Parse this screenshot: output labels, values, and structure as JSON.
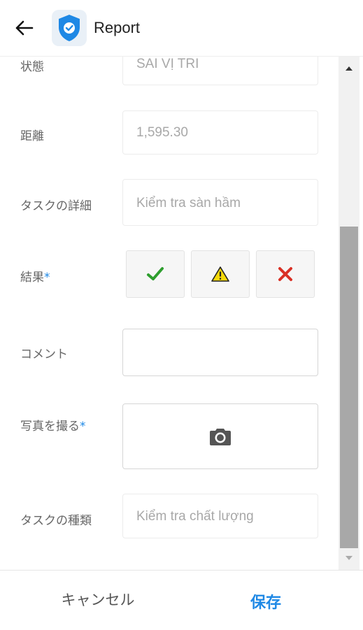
{
  "header": {
    "title": "Report",
    "back_icon": "arrow-left-icon",
    "logo_icon": "shield-check-icon"
  },
  "form": {
    "status": {
      "label": "状態",
      "value": "SAI VỊ TRI"
    },
    "distance": {
      "label": "距離",
      "value": "1,595.30"
    },
    "task_detail": {
      "label": "タスクの詳細",
      "value": "Kiểm tra sàn hầm"
    },
    "result": {
      "label": "結果",
      "required_mark": "*",
      "options": [
        "check-icon",
        "warning-icon",
        "close-icon"
      ]
    },
    "comment": {
      "label": "コメント",
      "value": ""
    },
    "photo": {
      "label": "写真を撮る",
      "required_mark": "*",
      "icon": "camera-icon"
    },
    "task_type": {
      "label": "タスクの種類",
      "value": "Kiểm tra chất lượng"
    }
  },
  "footer": {
    "cancel_label": "キャンセル",
    "save_label": "保存"
  },
  "colors": {
    "accent": "#1e88e5",
    "success": "#2e9e2e",
    "warning": "#f5d90a",
    "danger": "#d93025"
  }
}
